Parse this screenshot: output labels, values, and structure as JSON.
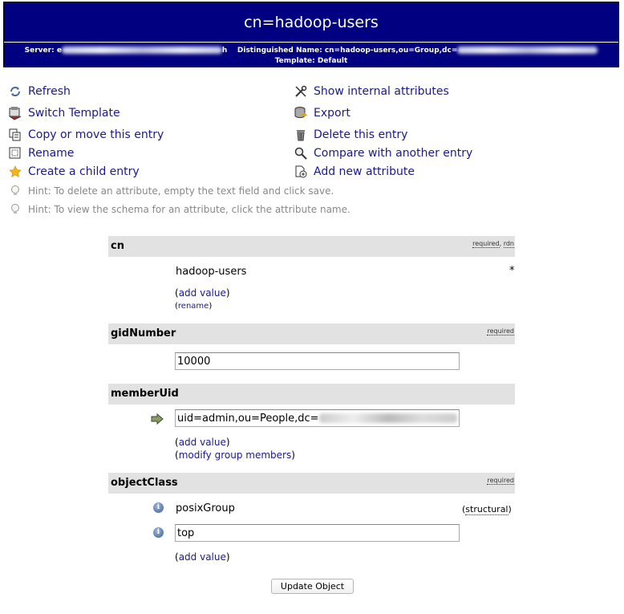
{
  "header": {
    "title": "cn=hadoop-users",
    "server_label": "Server:",
    "server_value_start": "e",
    "server_value_end": "h",
    "dn_label": "Distinguished Name:",
    "dn_value": "cn=hadoop-users,ou=Group,dc=",
    "template_label": "Template:",
    "template_value": "Default"
  },
  "actions": {
    "refresh": "Refresh",
    "switch_template": "Switch Template",
    "copy_move": "Copy or move this entry",
    "rename": "Rename",
    "create_child": "Create a child entry",
    "show_internal": "Show internal attributes",
    "export": "Export",
    "delete": "Delete this entry",
    "compare": "Compare with another entry",
    "add_attribute": "Add new attribute"
  },
  "hints": [
    "Hint: To delete an attribute, empty the text field and click save.",
    "Hint: To view the schema for an attribute, click the attribute name."
  ],
  "attributes": {
    "cn": {
      "name": "cn",
      "flag_required": "required",
      "flag_rdn": "rdn",
      "value": "hadoop-users",
      "rdn_marker": "*",
      "add_value": "add value",
      "rename": "rename"
    },
    "gidNumber": {
      "name": "gidNumber",
      "flag_required": "required",
      "value": "10000"
    },
    "memberUid": {
      "name": "memberUid",
      "value": "uid=admin,ou=People,dc=",
      "add_value": "add value",
      "modify_members": "modify group members"
    },
    "objectClass": {
      "name": "objectClass",
      "flag_required": "required",
      "values": [
        "posixGroup",
        "top"
      ],
      "structural": "structural",
      "add_value": "add value"
    }
  },
  "update_button": "Update Object",
  "colors": {
    "header_bg": "#000080",
    "link": "#1a1a8c",
    "attr_header_bg": "#e2e2e2",
    "hint": "#888888"
  }
}
